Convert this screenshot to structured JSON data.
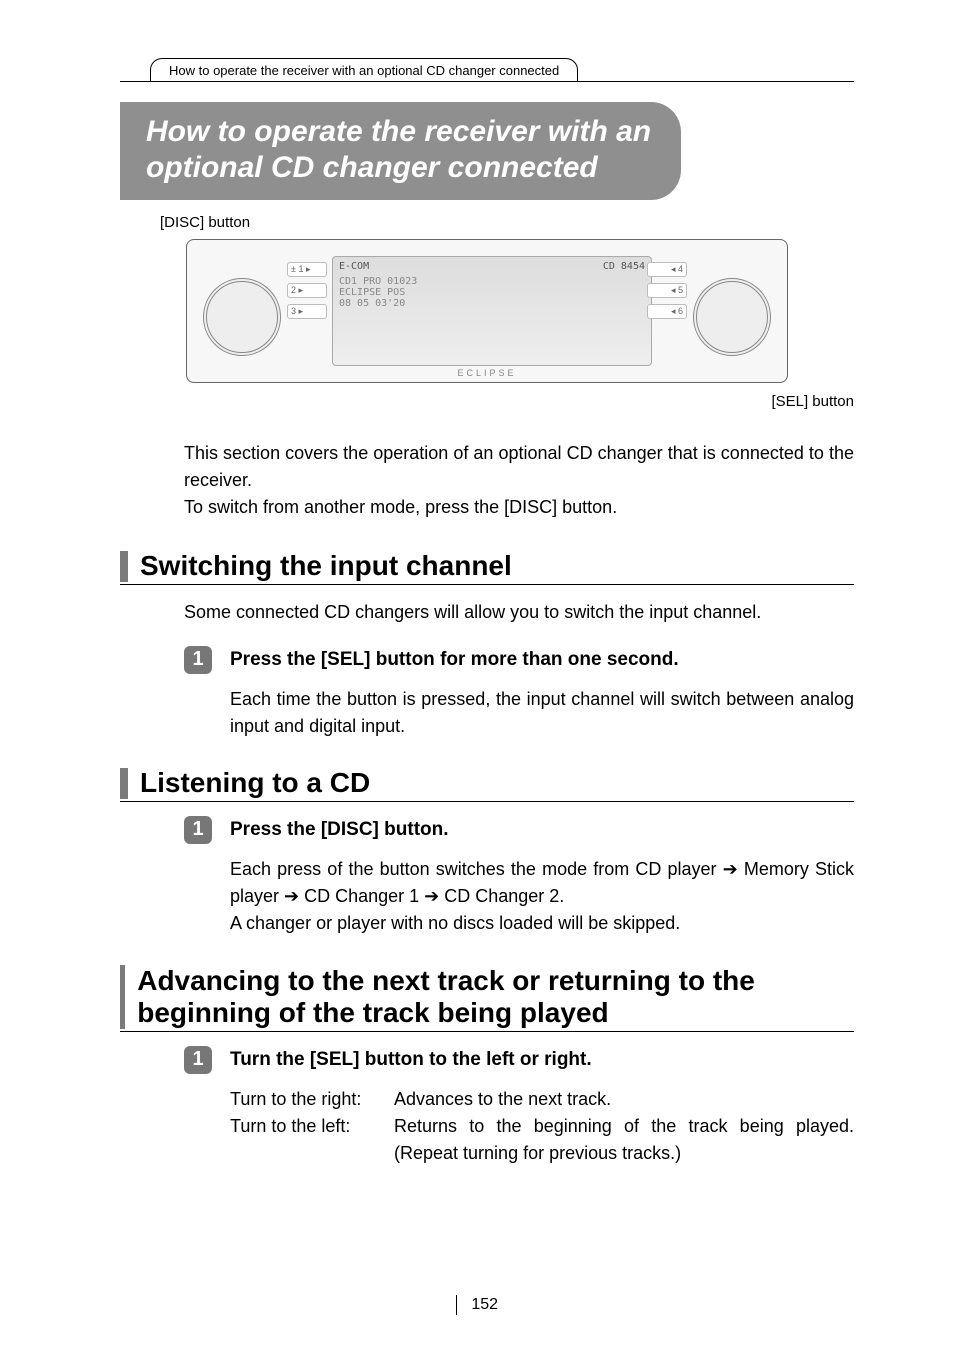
{
  "top_tab": "How to operate the receiver with an optional CD changer connected",
  "banner_line1": "How to operate the receiver with an",
  "banner_line2": "optional CD changer connected",
  "callout_disc": "[DISC] button",
  "callout_sel": "[SEL] button",
  "diagram": {
    "model": "CD 8454",
    "brand_text": "ECLIPSE",
    "display_line1": "CD1  PRO          01023",
    "display_line2": "ECLIPSE      POS",
    "display_line3": "08 05   03'20",
    "econ_logo": "E-COM"
  },
  "intro_p1": "This section covers the operation of an optional CD changer that is connected to the receiver.",
  "intro_p2": "To switch from another mode, press the [DISC] button.",
  "sections": {
    "switching": {
      "title": "Switching the input channel",
      "desc": "Some connected CD changers will allow you to switch the input channel.",
      "step1_title": "Press the [SEL] button for more than one second.",
      "step1_body": "Each time the button is pressed, the input channel will switch between analog input and digital input."
    },
    "listening": {
      "title": "Listening to a CD",
      "step1_title": "Press the [DISC] button.",
      "step1_body": "Each press of the button switches the mode from CD player ➔ Memory Stick player ➔ CD Changer 1 ➔ CD Changer 2.\nA changer or player with no discs loaded will be skipped."
    },
    "advancing": {
      "title": "Advancing to the next track or returning to the beginning of the track being played",
      "step1_title": "Turn the [SEL] button to the left or right.",
      "right_label": "Turn to the right:",
      "right_text": "Advances to the next track.",
      "left_label": "Turn to the left:",
      "left_text": "Returns to the beginning of the track being played. (Repeat turning for previous tracks.)"
    }
  },
  "page_number": "152",
  "step_numeral": "1"
}
